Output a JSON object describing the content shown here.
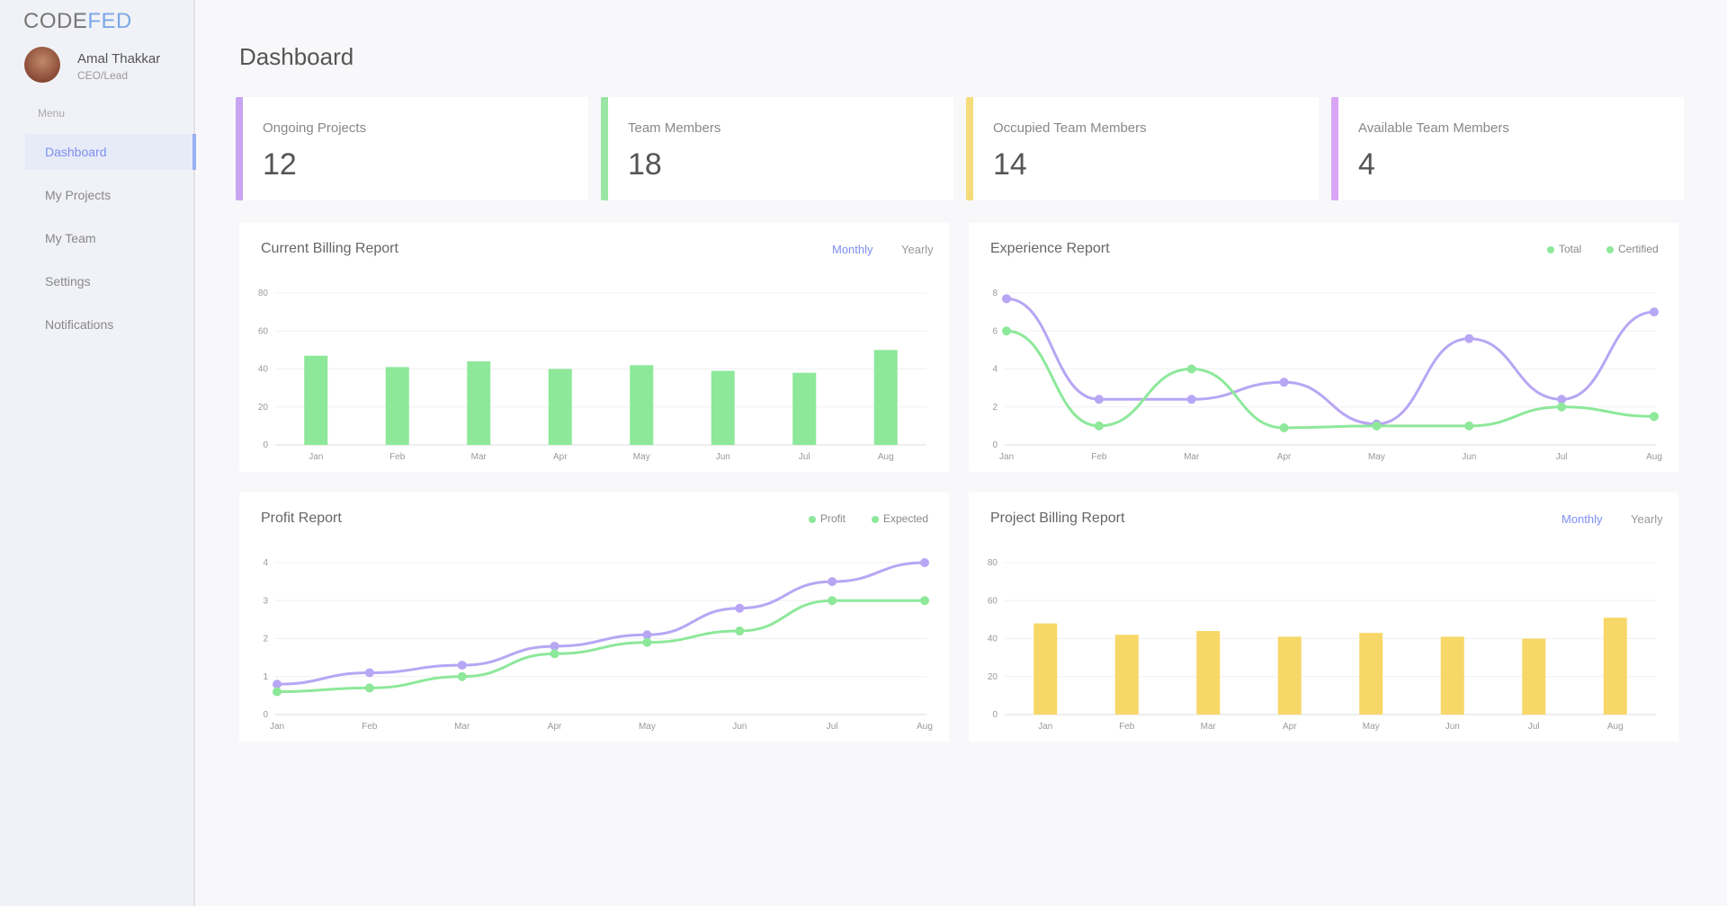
{
  "brand": {
    "part1": "CODE",
    "part2": "FED"
  },
  "user": {
    "name": "Amal Thakkar",
    "role": "CEO/Lead"
  },
  "sidebar": {
    "menu_label": "Menu",
    "items": [
      {
        "label": "Dashboard"
      },
      {
        "label": "My Projects"
      },
      {
        "label": "My Team"
      },
      {
        "label": "Settings"
      },
      {
        "label": "Notifications"
      }
    ]
  },
  "page_title": "Dashboard",
  "stats": [
    {
      "label": "Ongoing Projects",
      "value": "12",
      "color": "#c9a4f2"
    },
    {
      "label": "Team Members",
      "value": "18",
      "color": "#9ae6a4"
    },
    {
      "label": "Occupied Team Members",
      "value": "14",
      "color": "#f5dc7a"
    },
    {
      "label": "Available Team Members",
      "value": "4",
      "color": "#d9a6f5"
    }
  ],
  "panels": {
    "billing": {
      "title": "Current Billing Report",
      "toggle_a": "Monthly",
      "toggle_b": "Yearly"
    },
    "experience": {
      "title": "Experience Report",
      "legend": [
        "Total",
        "Certified"
      ]
    },
    "profit": {
      "title": "Profit Report",
      "legend": [
        "Profit",
        "Expected"
      ]
    },
    "project_billing": {
      "title": "Project Billing Report",
      "toggle_a": "Monthly",
      "toggle_b": "Yearly"
    }
  },
  "colors": {
    "accent": "#7d8ff0",
    "green": "#8de89a",
    "purple": "#b7a6f4",
    "yellow": "#f7d768"
  },
  "chart_data": [
    {
      "type": "bar",
      "categories": [
        "Jan",
        "Feb",
        "Mar",
        "Apr",
        "May",
        "Jun",
        "Jul",
        "Aug"
      ],
      "values": [
        47,
        41,
        44,
        40,
        42,
        39,
        38,
        50
      ],
      "y_ticks": [
        "0",
        "20",
        "40",
        "60",
        "80"
      ],
      "ylim": [
        0,
        80
      ],
      "color": "#8de89a"
    },
    {
      "type": "line",
      "categories": [
        "Jan",
        "Feb",
        "Mar",
        "Apr",
        "May",
        "Jun",
        "Jul",
        "Aug"
      ],
      "series": [
        {
          "name": "Total",
          "values": [
            7.7,
            2.4,
            2.4,
            3.3,
            1.1,
            5.6,
            2.4,
            7.0
          ],
          "color": "#b7a6f4"
        },
        {
          "name": "Certified",
          "values": [
            6.0,
            1.0,
            4.0,
            0.9,
            1.0,
            1.0,
            2.0,
            1.5
          ],
          "color": "#8de89a"
        }
      ],
      "y_ticks": [
        "0",
        "2",
        "4",
        "6",
        "8"
      ],
      "ylim": [
        0,
        8
      ]
    },
    {
      "type": "line",
      "categories": [
        "Jan",
        "Feb",
        "Mar",
        "Apr",
        "May",
        "Jun",
        "Jul",
        "Aug"
      ],
      "series": [
        {
          "name": "Profit",
          "values": [
            0.8,
            1.1,
            1.3,
            1.8,
            2.1,
            2.8,
            3.5,
            4.0
          ],
          "color": "#b7a6f4"
        },
        {
          "name": "Expected",
          "values": [
            0.6,
            0.7,
            1.0,
            1.6,
            1.9,
            2.2,
            3.0,
            3.0
          ],
          "color": "#8de89a"
        }
      ],
      "y_ticks": [
        "0",
        "1",
        "2",
        "3",
        "4"
      ],
      "ylim": [
        0,
        4
      ]
    },
    {
      "type": "bar",
      "categories": [
        "Jan",
        "Feb",
        "Mar",
        "Apr",
        "May",
        "Jun",
        "Jul",
        "Aug"
      ],
      "values": [
        48,
        42,
        44,
        41,
        43,
        41,
        40,
        51
      ],
      "y_ticks": [
        "0",
        "20",
        "40",
        "60",
        "80"
      ],
      "ylim": [
        0,
        80
      ],
      "color": "#f7d768"
    }
  ]
}
